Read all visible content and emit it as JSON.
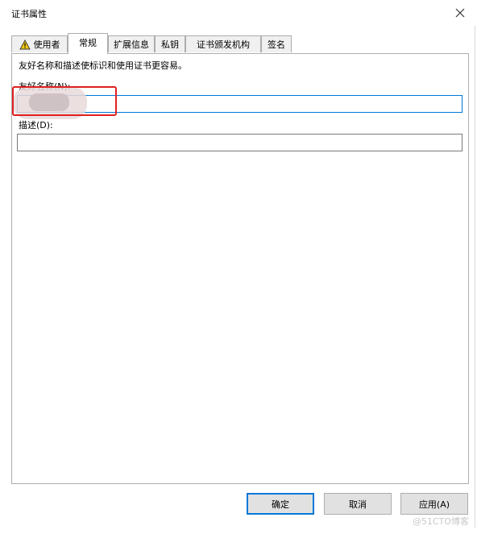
{
  "window": {
    "title": "证书属性"
  },
  "tabs": [
    {
      "label": "使用者",
      "icon": "warning-icon"
    },
    {
      "label": "常规"
    },
    {
      "label": "扩展信息"
    },
    {
      "label": "私钥"
    },
    {
      "label": "证书颁发机构"
    },
    {
      "label": "签名"
    }
  ],
  "general": {
    "hint": "友好名称和描述使标识和使用证书更容易。",
    "friendly_name_label": "友好名称(N):",
    "friendly_name_value": "",
    "description_label": "描述(D):",
    "description_value": ""
  },
  "buttons": {
    "ok": "确定",
    "cancel": "取消",
    "apply": "应用(A)"
  },
  "watermark": "@51CTO博客",
  "colors": {
    "accent": "#0078d7",
    "highlight": "#e02020",
    "warning": "#f2c811"
  }
}
